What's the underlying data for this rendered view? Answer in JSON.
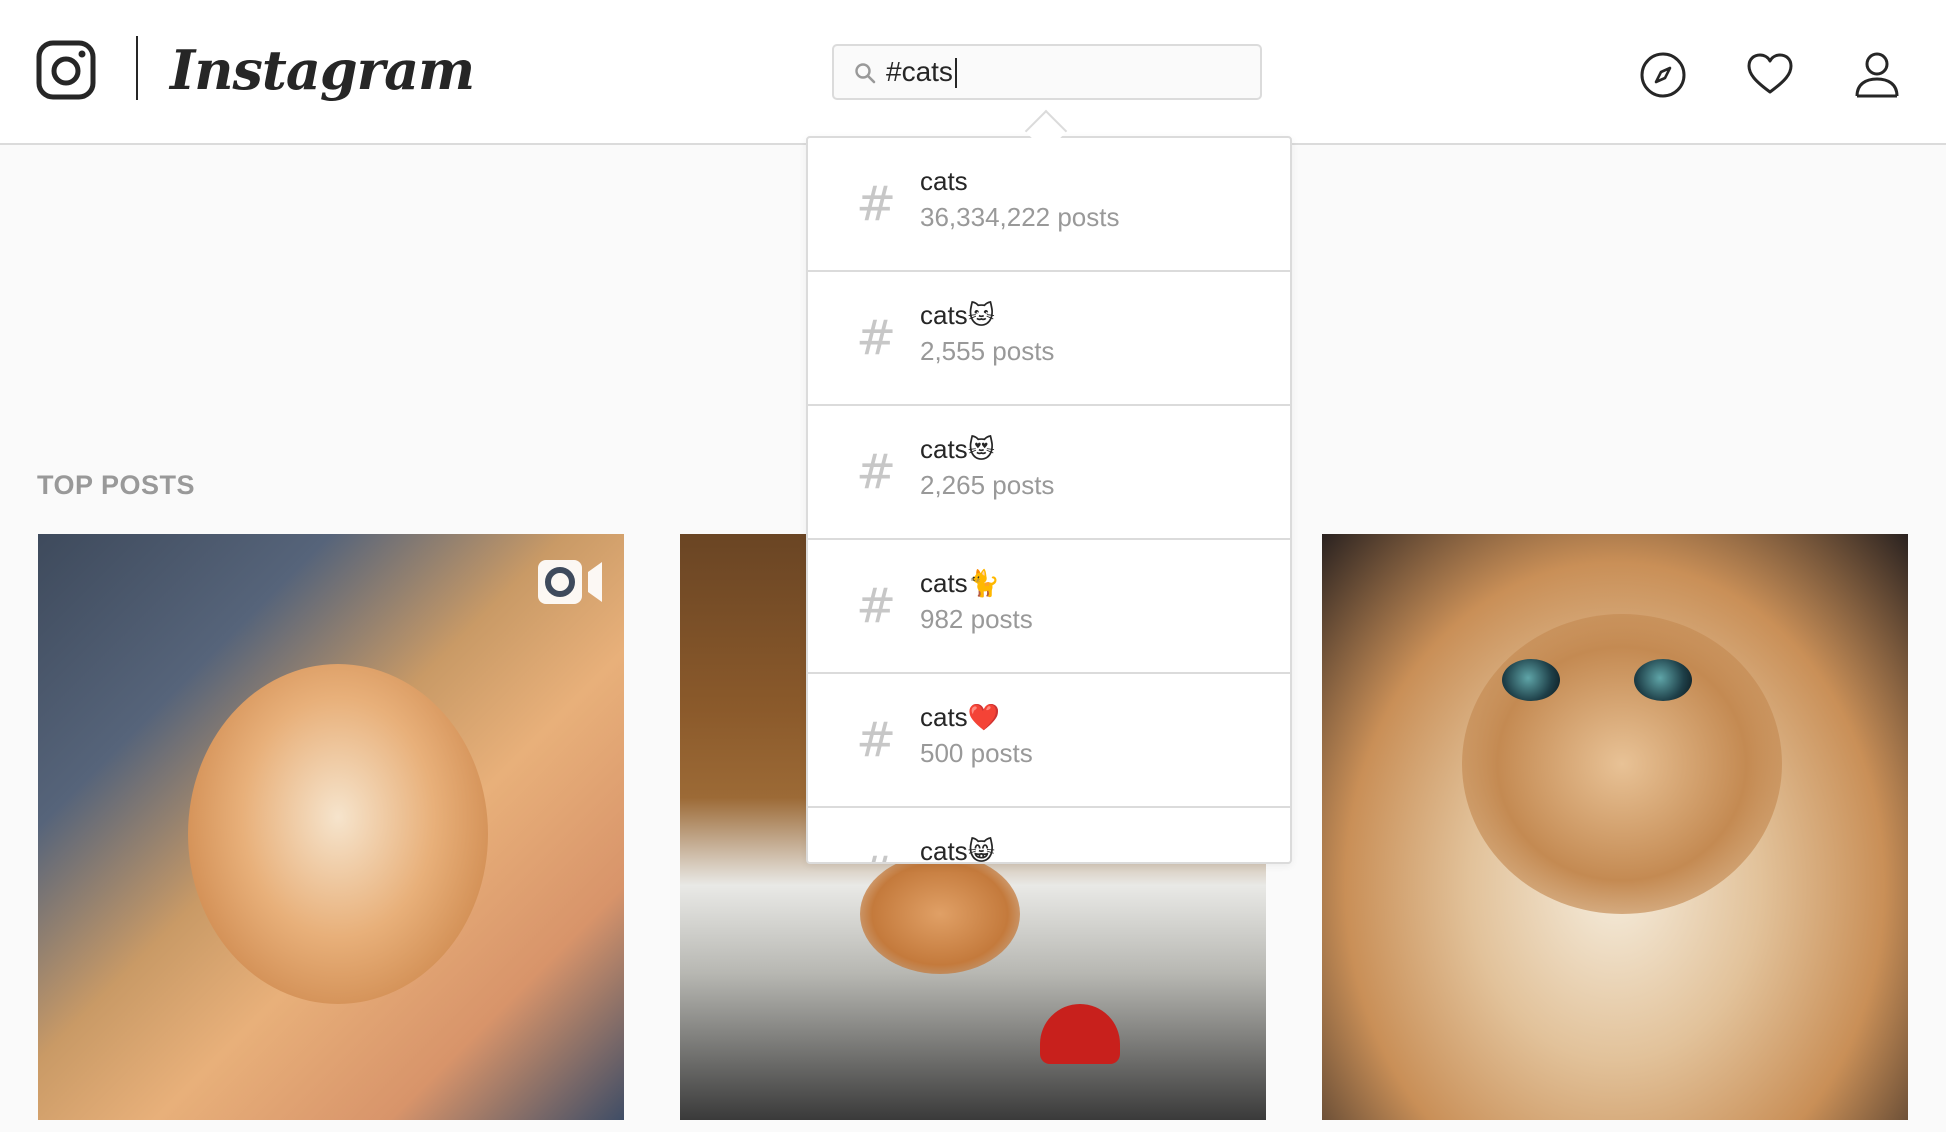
{
  "header": {
    "wordmark": "Instagram",
    "search": {
      "value": "#cats"
    },
    "nav": [
      "explore-icon",
      "heart-icon",
      "profile-icon"
    ]
  },
  "section_title": "TOP POSTS",
  "search_results": [
    {
      "tag": "cats",
      "emoji": "",
      "count": "36,334,222 posts"
    },
    {
      "tag": "cats",
      "emoji": "🐱",
      "count": "2,555 posts"
    },
    {
      "tag": "cats",
      "emoji": "😻",
      "count": "2,265 posts"
    },
    {
      "tag": "cats",
      "emoji": "🐈",
      "count": "982 posts"
    },
    {
      "tag": "cats",
      "emoji": "❤️",
      "count": "500 posts"
    },
    {
      "tag": "cats",
      "emoji": "😸",
      "count": ""
    }
  ],
  "posts": [
    {
      "kind": "video",
      "icon": "video-icon"
    },
    {
      "kind": "photo"
    },
    {
      "kind": "photo"
    }
  ]
}
